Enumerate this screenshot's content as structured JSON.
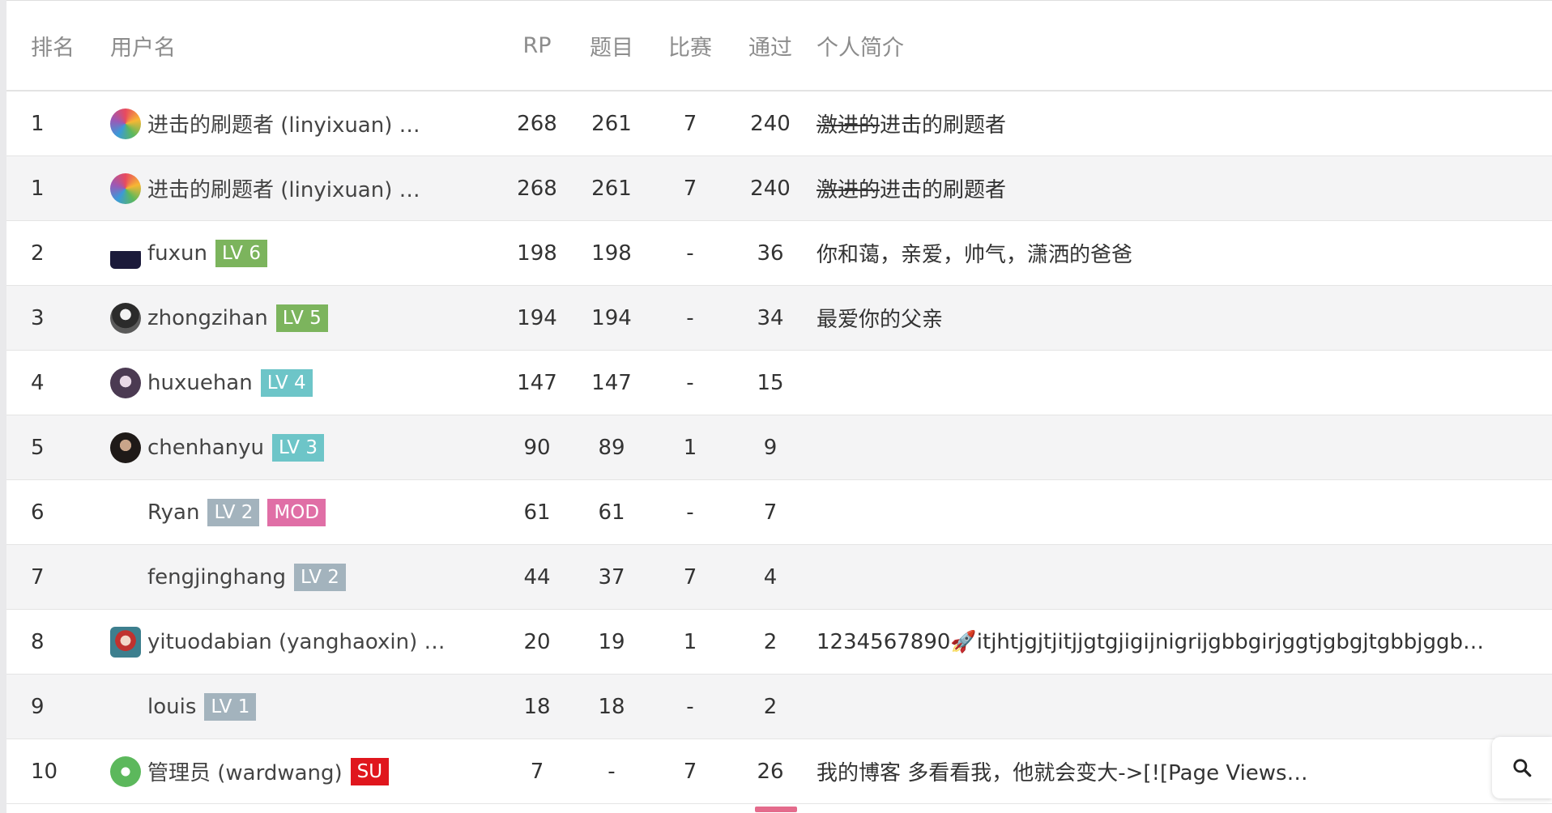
{
  "headers": {
    "rank": "排名",
    "user": "用户名",
    "rp": "RP",
    "problems": "题目",
    "contests": "比赛",
    "accepted": "通过",
    "bio": "个人简介"
  },
  "colors": {
    "badge_green": "#7cb45d",
    "badge_teal": "#6dc5c8",
    "badge_gray": "#a3b3bd",
    "badge_pink": "#e06fa6",
    "badge_red": "#e0161d"
  },
  "rows": [
    {
      "rank": "1",
      "avatar": "colorful-flower-avatar",
      "name": "进击的刷题者 (linyixuan) …",
      "badges": [],
      "rp": "268",
      "problems": "261",
      "contests": "7",
      "accepted": "240",
      "bio_strike": "激进的",
      "bio": "进击的刷题者"
    },
    {
      "rank": "1",
      "avatar": "colorful-flower-avatar",
      "name": "进击的刷题者 (linyixuan) …",
      "badges": [],
      "rp": "268",
      "problems": "261",
      "contests": "7",
      "accepted": "240",
      "bio_strike": "激进的",
      "bio": "进击的刷题者"
    },
    {
      "rank": "2",
      "avatar": "dark-dome-avatar",
      "name": "fuxun",
      "badges": [
        {
          "label": "LV 6",
          "color": "#7cb45d"
        }
      ],
      "rp": "198",
      "problems": "198",
      "contests": "-",
      "accepted": "36",
      "bio_strike": "",
      "bio": "你和蔼，亲爱，帅气，潇洒的爸爸"
    },
    {
      "rank": "3",
      "avatar": "person-photo-avatar",
      "name": "zhongzihan",
      "badges": [
        {
          "label": "LV 5",
          "color": "#7cb45d"
        }
      ],
      "rp": "194",
      "problems": "194",
      "contests": "-",
      "accepted": "34",
      "bio_strike": "",
      "bio": "最爱你的父亲"
    },
    {
      "rank": "4",
      "avatar": "anime-avatar",
      "name": "huxuehan",
      "badges": [
        {
          "label": "LV 4",
          "color": "#6dc5c8"
        }
      ],
      "rp": "147",
      "problems": "147",
      "contests": "-",
      "accepted": "15",
      "bio_strike": "",
      "bio": ""
    },
    {
      "rank": "5",
      "avatar": "portrait-avatar",
      "name": "chenhanyu",
      "badges": [
        {
          "label": "LV 3",
          "color": "#6dc5c8"
        }
      ],
      "rp": "90",
      "problems": "89",
      "contests": "1",
      "accepted": "9",
      "bio_strike": "",
      "bio": ""
    },
    {
      "rank": "6",
      "avatar": "",
      "name": "Ryan",
      "badges": [
        {
          "label": "LV 2",
          "color": "#a3b3bd"
        },
        {
          "label": "MOD",
          "color": "#e06fa6"
        }
      ],
      "rp": "61",
      "problems": "61",
      "contests": "-",
      "accepted": "7",
      "bio_strike": "",
      "bio": ""
    },
    {
      "rank": "7",
      "avatar": "",
      "name": "fengjinghang",
      "badges": [
        {
          "label": "LV 2",
          "color": "#a3b3bd"
        }
      ],
      "rp": "44",
      "problems": "37",
      "contests": "7",
      "accepted": "4",
      "bio_strike": "",
      "bio": ""
    },
    {
      "rank": "8",
      "avatar": "red-character-avatar",
      "name": "yituodabian (yanghaoxin) …",
      "badges": [],
      "rp": "20",
      "problems": "19",
      "contests": "1",
      "accepted": "2",
      "bio_strike": "",
      "bio": "1234567890🚀itjhtjgjtjitjjgtgjigijnigrijgbbgirjggtjgbgjtgbbjggb…"
    },
    {
      "rank": "9",
      "avatar": "",
      "name": "louis",
      "badges": [
        {
          "label": "LV 1",
          "color": "#a3b3bd"
        }
      ],
      "rp": "18",
      "problems": "18",
      "contests": "-",
      "accepted": "2",
      "bio_strike": "",
      "bio": ""
    },
    {
      "rank": "10",
      "avatar": "green-mascot-avatar",
      "name": "管理员 (wardwang)",
      "badges": [
        {
          "label": "SU",
          "color": "#e0161d"
        }
      ],
      "rp": "7",
      "problems": "-",
      "contests": "7",
      "accepted": "26",
      "bio_strike": "",
      "bio": "我的博客 多看看我，他就会变大->[![Page Views…"
    }
  ],
  "search_icon": "search-icon"
}
